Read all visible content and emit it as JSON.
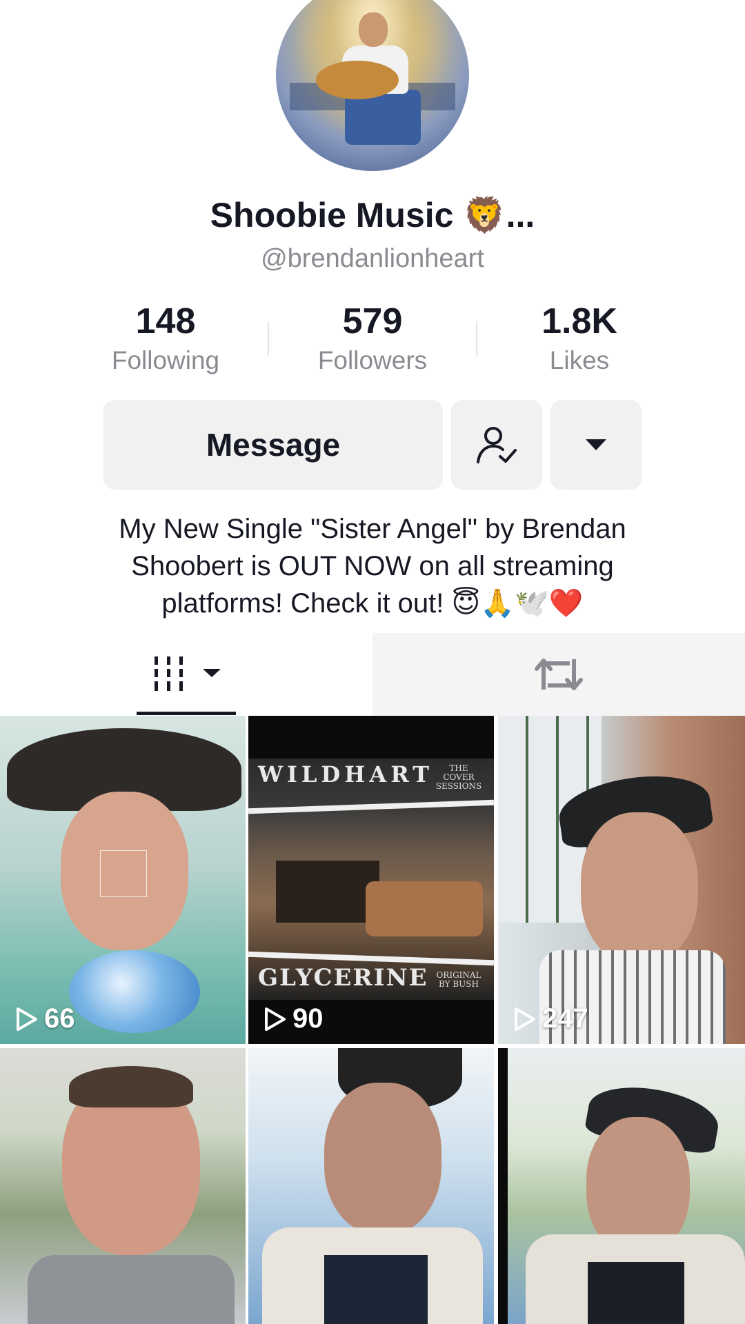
{
  "profile": {
    "display_name": "Shoobie Music 🦁...",
    "handle": "@brendanlionheart",
    "avatar_icon": "profile-avatar-photo"
  },
  "stats": {
    "following": {
      "value": "148",
      "label": "Following"
    },
    "followers": {
      "value": "579",
      "label": "Followers"
    },
    "likes": {
      "value": "1.8K",
      "label": "Likes"
    }
  },
  "actions": {
    "message_label": "Message",
    "friend_icon": "user-check-icon",
    "more_icon": "caret-down-icon"
  },
  "bio": {
    "line1": "My New Single \"Sister Angel\" by Brendan",
    "line2": "Shoobert is OUT NOW on all streaming",
    "line3": "platforms! Check it out! 😇🙏🕊️❤️"
  },
  "tabs": {
    "videos_icon": "grid-icon",
    "reposts_icon": "repost-icon"
  },
  "videos": [
    {
      "plays": "66",
      "thumb": "man-in-hat"
    },
    {
      "plays": "90",
      "thumb": "wildhart-glycerine-cover",
      "poster": {
        "title_top": "WILDHART",
        "title_bottom": "GLYCERINE",
        "tag_top": "THE COVER SESSIONS",
        "tag_bottom": "ORIGINAL BY BUSH"
      }
    },
    {
      "plays": "247",
      "thumb": "man-on-porch"
    },
    {
      "plays": "",
      "thumb": "man-closeup"
    },
    {
      "plays": "",
      "thumb": "man-in-cap-sky"
    },
    {
      "plays": "",
      "thumb": "man-under-tree"
    }
  ],
  "colors": {
    "text": "#161823",
    "muted": "#8a8b91",
    "button_bg": "#f1f1f2"
  }
}
